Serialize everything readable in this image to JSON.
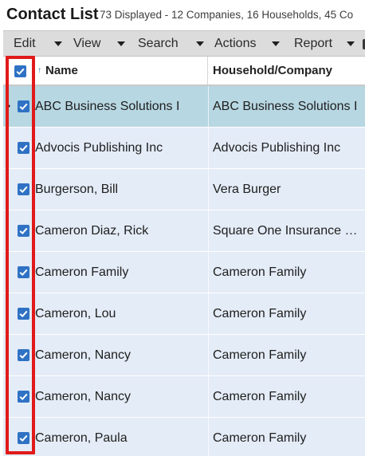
{
  "title": "Contact List",
  "summary": "73 Displayed - 12 Companies, 16 Households, 45 Co",
  "menu": {
    "edit": "Edit",
    "view": "View",
    "search": "Search",
    "actions": "Actions",
    "report": "Report"
  },
  "columns": {
    "name": "Name",
    "household": "Household/Company",
    "sort_indicator": "↑"
  },
  "rows": [
    {
      "name": "ABC Business Solutions I",
      "household": "ABC Business Solutions I",
      "checked": true,
      "selected": true
    },
    {
      "name": "Advocis Publishing Inc",
      "household": "Advocis Publishing Inc",
      "checked": true,
      "selected": false
    },
    {
      "name": "Burgerson, Bill",
      "household": "Vera Burger",
      "checked": true,
      "selected": false
    },
    {
      "name": "Cameron Diaz, Rick",
      "household": "Square One Insurance Services",
      "checked": true,
      "selected": false
    },
    {
      "name": "Cameron Family",
      "household": "Cameron Family",
      "checked": true,
      "selected": false
    },
    {
      "name": "Cameron, Lou",
      "household": "Cameron Family",
      "checked": true,
      "selected": false
    },
    {
      "name": "Cameron, Nancy",
      "household": "Cameron Family",
      "checked": true,
      "selected": false
    },
    {
      "name": "Cameron, Nancy",
      "household": "Cameron Family",
      "checked": true,
      "selected": false
    },
    {
      "name": "Cameron, Paula",
      "household": "Cameron Family",
      "checked": true,
      "selected": false
    }
  ],
  "colors": {
    "selected_row": "#b7d7e2",
    "row": "#e4ecf7",
    "checkbox": "#2f72c4",
    "highlight": "#e01a1a"
  },
  "icons": {
    "checkbox": "checkmark-icon",
    "sort": "sort-ascending-icon",
    "menu": "caret-down-icon",
    "row_pointer": "row-pointer-icon"
  }
}
